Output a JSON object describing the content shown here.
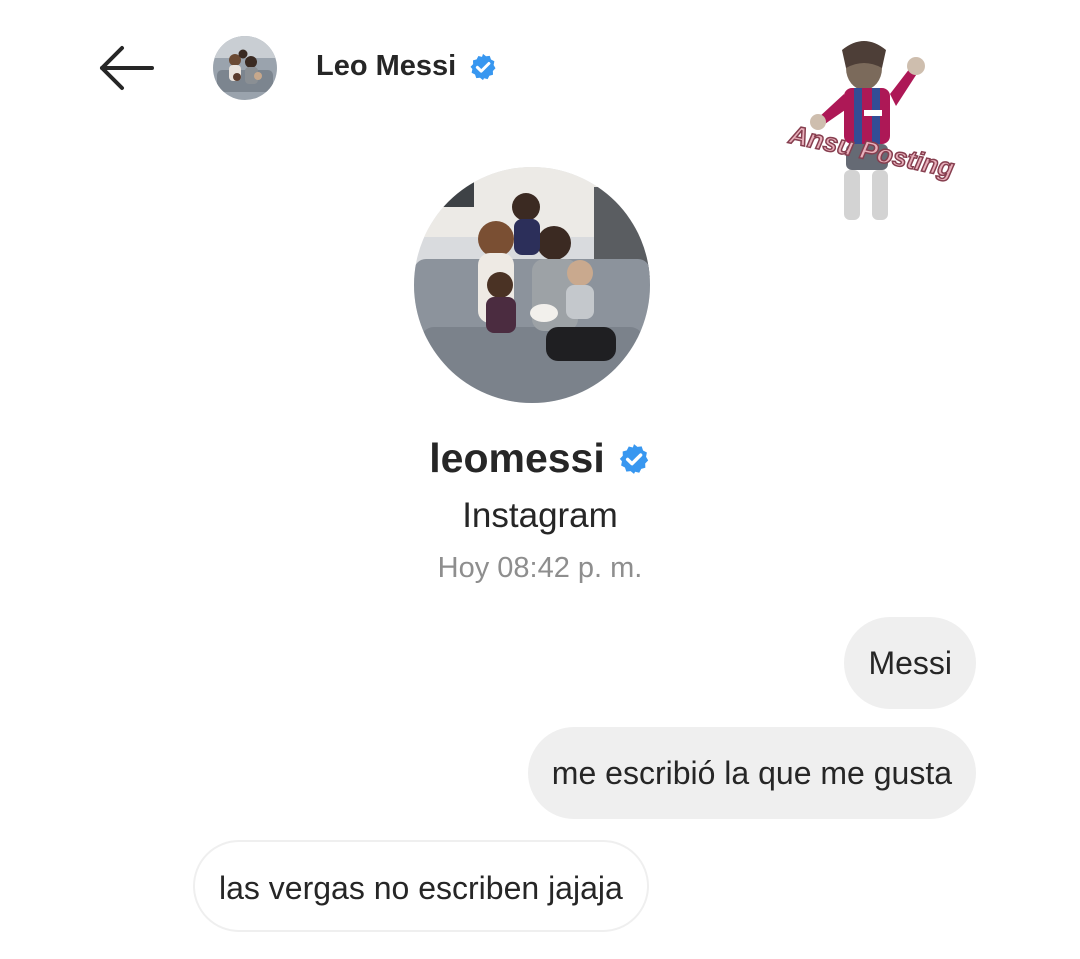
{
  "header": {
    "back_icon": "arrow-left-icon",
    "name": "Leo Messi",
    "verified_icon": "verified-badge-icon"
  },
  "watermark": {
    "text": "Ansu Posting"
  },
  "profile": {
    "username": "leomessi",
    "subtitle": "Instagram",
    "timestamp": "Hoy 08:42 p. m."
  },
  "messages": [
    {
      "direction": "sent",
      "text": "Messi"
    },
    {
      "direction": "sent",
      "text": "me escribió la que me gusta"
    },
    {
      "direction": "received",
      "text": "las vergas no escriben jajaja"
    }
  ],
  "colors": {
    "verified_blue": "#3897f0",
    "sent_bubble": "#efefef",
    "timestamp_gray": "#8e8e8e",
    "text": "#262626"
  }
}
